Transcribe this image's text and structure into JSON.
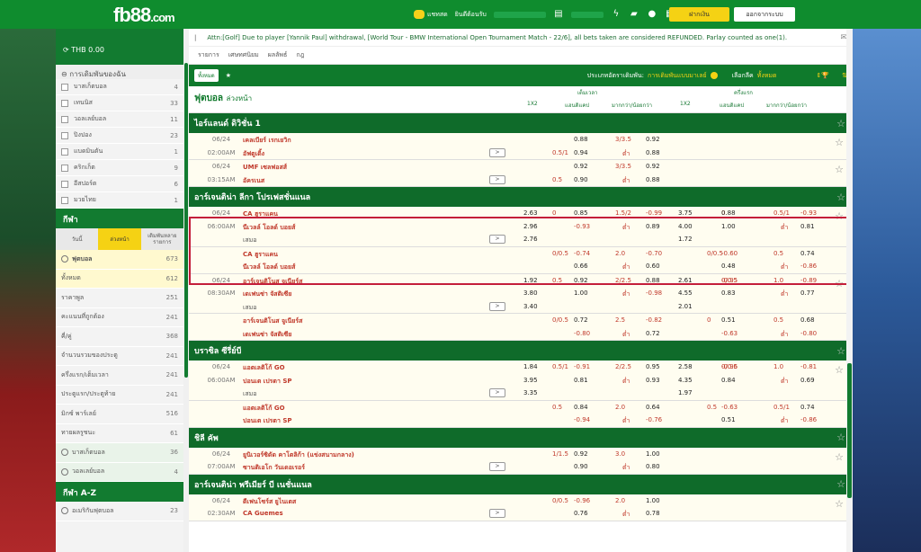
{
  "header": {
    "logo_main": "fb88",
    "logo_suffix": ".com",
    "chat_label": "แชทสด",
    "balance_label": "ยินดีต้อนรับ",
    "deposit_button": "ฝากเงิน",
    "logout_button": "ออกจากระบบ"
  },
  "sidebar": {
    "balance": "THB 0.00",
    "my_bets_title": "การเดิมพันของฉัน",
    "sports": [
      {
        "label": "บาสเก็ตบอล",
        "count": "4"
      },
      {
        "label": "เทนนิส",
        "count": "33"
      },
      {
        "label": "วอลเลย์บอล",
        "count": "11"
      },
      {
        "label": "ปิงปอง",
        "count": "23"
      },
      {
        "label": "แบดมินตัน",
        "count": "1"
      },
      {
        "label": "คริกเก็ต",
        "count": "9"
      },
      {
        "label": "อีสปอร์ต",
        "count": "6"
      },
      {
        "label": "มวยไทย",
        "count": "1"
      }
    ],
    "sports_section": "กีฬา",
    "tabs": [
      "วันนี้",
      "ล่วงหน้า",
      "เดิมพันหลายรายการ"
    ],
    "active_tab": "ล่วงหน้า",
    "football_label": "ฟุตบอล",
    "football_count": "673",
    "markets": [
      {
        "label": "ทั้งหมด",
        "count": "612",
        "active": true
      },
      {
        "label": "ราคาพูล",
        "count": "251"
      },
      {
        "label": "คะแนนที่ถูกต้อง",
        "count": "241"
      },
      {
        "label": "คี่/คู่",
        "count": "368"
      },
      {
        "label": "จำนวนรวมของประตู",
        "count": "241"
      },
      {
        "label": "ครึ่งแรก/เต็มเวลา",
        "count": "241"
      },
      {
        "label": "ประตูแรก/ประตูท้าย",
        "count": "241"
      },
      {
        "label": "มิกซ์ พาร์เลย์",
        "count": "516"
      },
      {
        "label": "ทายผลรูชนะ",
        "count": "61"
      }
    ],
    "other_sports": [
      {
        "label": "บาสเก็ตบอล",
        "count": "36"
      },
      {
        "label": "วอลเลย์บอล",
        "count": "4"
      }
    ],
    "az_section": "กีฬา A-Z",
    "az_first": {
      "label": "อเมริกันฟุตบอล",
      "count": "23"
    }
  },
  "announcement": "Attn:[Golf] Due to player [Yannik Paul] withdrawal, [World Tour - BMW International Open Tournament Match - 22/6], all bets taken are considered REFUNDED. Parlay counted as one(1).",
  "nav": [
    "รายการ",
    "เศษทศนิยม",
    "ผลลัพธ์",
    "กฎ"
  ],
  "toolbar": {
    "all_label": "ทั้งหมด",
    "odds_type_label": "ประเภทอัตราเดิมพัน:",
    "odds_type_value": "การเดิมพันแบบมาเลย์",
    "select_league_label": "เลือกลีค",
    "select_league_value": "ทั้งหมด"
  },
  "table_header": {
    "title_main": "ฟุตบอล",
    "title_sub": "ล่วงหน้า",
    "fulltime": "เต็มเวลา",
    "halftime": "ครึ่งแรก",
    "col_1x2": "1X2",
    "col_hdp": "แฮนดิแคป",
    "col_ou": "มากกว่า/น้อยกว่า"
  },
  "leagues": [
    {
      "name": "ไอร์แลนด์ ดิวิชั่น 1",
      "matches": [
        {
          "date": "06/24",
          "time": "02:00AM",
          "home": "เคลเบียร์ เรกเยวิก",
          "away": "อัฟตูเดิ้ง",
          "draw": "",
          "ft_1x2": [
            "",
            "",
            ""
          ],
          "ft_hdp": [
            [
              "",
              "0.88"
            ],
            [
              "0.5/1",
              "0.94"
            ]
          ],
          "ft_ou": [
            [
              "3/3.5",
              "0.92"
            ],
            [
              "ต่ำ",
              "0.88"
            ]
          ],
          "ht_1x2": [
            "",
            "",
            ""
          ],
          "ht_hdp": [
            [
              "",
              ""
            ],
            [
              "",
              ""
            ]
          ],
          "ht_ou": [
            [
              "",
              ""
            ],
            [
              "",
              ""
            ]
          ]
        },
        {
          "date": "06/24",
          "time": "03:15AM",
          "home": "UMF เซลฟอสส์",
          "away": "อัครเนส",
          "draw": "",
          "ft_1x2": [
            "",
            "",
            ""
          ],
          "ft_hdp": [
            [
              "",
              "0.92"
            ],
            [
              "0.5",
              "0.90"
            ]
          ],
          "ft_ou": [
            [
              "3/3.5",
              "0.92"
            ],
            [
              "ต่ำ",
              "0.88"
            ]
          ],
          "ht_1x2": [
            "",
            "",
            ""
          ],
          "ht_hdp": [
            [
              "",
              ""
            ],
            [
              "",
              ""
            ]
          ],
          "ht_ou": [
            [
              "",
              ""
            ],
            [
              "",
              ""
            ]
          ]
        }
      ]
    },
    {
      "name": "อาร์เจนติน่า ลีกา โปรเฟสชั่นแนล",
      "matches": [
        {
          "date": "06/24",
          "time": "06:00AM",
          "home": "CA ฮูราแคน",
          "away": "นีเวลล์ โอลด์ บอยส์",
          "draw": "เสมอ",
          "ft_1x2": [
            "2.63",
            "2.96",
            "2.76"
          ],
          "ft_hdp": [
            [
              "0",
              "0.85"
            ],
            [
              "",
              "-0.93"
            ]
          ],
          "ft_ou": [
            [
              "1.5/2",
              "-0.99"
            ],
            [
              "ต่ำ",
              "0.89"
            ]
          ],
          "ht_1x2": [
            "3.75",
            "4.00",
            "1.72"
          ],
          "ht_hdp": [
            [
              "0",
              "0.88"
            ],
            [
              "",
              "1.00"
            ]
          ],
          "ht_ou": [
            [
              "0.5/1",
              "-0.93"
            ],
            [
              "ต่ำ",
              "0.81"
            ]
          ],
          "alt": {
            "home": "CA ฮูราแคน",
            "away": "นีเวลล์ โอลด์ บอยส์",
            "ft_hdp": [
              [
                "0/0.5",
                "-0.74"
              ],
              [
                "",
                "0.66"
              ]
            ],
            "ft_ou": [
              [
                "2.0",
                "-0.70"
              ],
              [
                "ต่ำ",
                "0.60"
              ]
            ],
            "ht_hdp": [
              [
                "0/0.5",
                "-0.60"
              ],
              [
                "",
                "0.48"
              ]
            ],
            "ht_ou": [
              [
                "0.5",
                "0.74"
              ],
              [
                "ต่ำ",
                "-0.86"
              ]
            ]
          }
        },
        {
          "date": "06/24",
          "time": "08:30AM",
          "home": "อาร์เจนติโนส จูเนียร์ส",
          "away": "เดเฟนซ่า จัสติเซีย",
          "draw": "เสมอ",
          "ft_1x2": [
            "1.92",
            "3.80",
            "3.40"
          ],
          "ft_hdp": [
            [
              "0.5",
              "0.92"
            ],
            [
              "",
              "1.00"
            ]
          ],
          "ft_ou": [
            [
              "2/2.5",
              "0.88"
            ],
            [
              "ต่ำ",
              "-0.98"
            ]
          ],
          "ht_1x2": [
            "2.61",
            "4.55",
            "2.01"
          ],
          "ht_hdp": [
            [
              "0/0.5",
              "-0.95"
            ],
            [
              "",
              "0.83"
            ]
          ],
          "ht_ou": [
            [
              "1.0",
              "-0.89"
            ],
            [
              "ต่ำ",
              "0.77"
            ]
          ],
          "alt": {
            "home": "อาร์เจนติโนส จูเนียร์ส",
            "away": "เดเฟนซ่า จัสติเซีย",
            "ft_hdp": [
              [
                "0/0.5",
                "0.72"
              ],
              [
                "",
                "-0.80"
              ]
            ],
            "ft_ou": [
              [
                "2.5",
                "-0.82"
              ],
              [
                "ต่ำ",
                "0.72"
              ]
            ],
            "ht_hdp": [
              [
                "0",
                "0.51"
              ],
              [
                "",
                "-0.63"
              ]
            ],
            "ht_ou": [
              [
                "0.5",
                "0.68"
              ],
              [
                "ต่ำ",
                "-0.80"
              ]
            ]
          }
        }
      ]
    },
    {
      "name": "บราซิล ซีรี่ย์บี",
      "matches": [
        {
          "date": "06/24",
          "time": "06:00AM",
          "home": "แอตเลติโก้ GO",
          "away": "ปอนเต เปรตา SP",
          "draw": "เสมอ",
          "ft_1x2": [
            "1.84",
            "3.95",
            "3.35"
          ],
          "ft_hdp": [
            [
              "0.5/1",
              "-0.91"
            ],
            [
              "",
              "0.81"
            ]
          ],
          "ft_ou": [
            [
              "2/2.5",
              "0.95"
            ],
            [
              "ต่ำ",
              "0.93"
            ]
          ],
          "ht_1x2": [
            "2.58",
            "4.35",
            "1.97"
          ],
          "ht_hdp": [
            [
              "0/0.5",
              "-0.96"
            ],
            [
              "",
              "0.84"
            ]
          ],
          "ht_ou": [
            [
              "1.0",
              "-0.81"
            ],
            [
              "ต่ำ",
              "0.69"
            ]
          ],
          "alt": {
            "home": "แอตเลติโก้ GO",
            "away": "ปอนเต เปรตา SP",
            "ft_hdp": [
              [
                "0.5",
                "0.84"
              ],
              [
                "",
                "-0.94"
              ]
            ],
            "ft_ou": [
              [
                "2.0",
                "0.64"
              ],
              [
                "ต่ำ",
                "-0.76"
              ]
            ],
            "ht_hdp": [
              [
                "0.5",
                "-0.63"
              ],
              [
                "",
                "0.51"
              ]
            ],
            "ht_ou": [
              [
                "0.5/1",
                "0.74"
              ],
              [
                "ต่ำ",
                "-0.86"
              ]
            ]
          }
        }
      ]
    },
    {
      "name": "ชิลี คัพ",
      "matches": [
        {
          "date": "06/24",
          "time": "07:00AM",
          "home": "ยูนิเวอร์ซิดัด คาโตลิก้า (แข่งสนามกลาง)",
          "away": "ซานติเอโก วันเดอเรอร์",
          "draw": "",
          "ft_1x2": [
            "",
            "",
            ""
          ],
          "ft_hdp": [
            [
              "1/1.5",
              "0.92"
            ],
            [
              "",
              "0.90"
            ]
          ],
          "ft_ou": [
            [
              "3.0",
              "1.00"
            ],
            [
              "ต่ำ",
              "0.80"
            ]
          ],
          "ht_1x2": [
            "",
            "",
            ""
          ],
          "ht_hdp": [
            [
              "",
              ""
            ],
            [
              "",
              ""
            ]
          ],
          "ht_ou": [
            [
              "",
              ""
            ],
            [
              "",
              ""
            ]
          ]
        }
      ]
    },
    {
      "name": "อาร์เจนติน่า พรีเมียร์ บี เนชั่นแนล",
      "matches": [
        {
          "date": "06/24",
          "time": "02:30AM",
          "home": "ดีเฟนโซร์ส ยูไนเตส",
          "away": "CA Guemes",
          "draw": "",
          "ft_1x2": [
            "",
            "",
            ""
          ],
          "ft_hdp": [
            [
              "0/0.5",
              "-0.96"
            ],
            [
              "",
              "0.76"
            ]
          ],
          "ft_ou": [
            [
              "2.0",
              "1.00"
            ],
            [
              "ต่ำ",
              "0.78"
            ]
          ],
          "ht_1x2": [
            "",
            "",
            ""
          ],
          "ht_hdp": [
            [
              "",
              ""
            ],
            [
              "",
              ""
            ]
          ],
          "ht_ou": [
            [
              "",
              ""
            ],
            [
              "",
              ""
            ]
          ]
        }
      ]
    }
  ]
}
